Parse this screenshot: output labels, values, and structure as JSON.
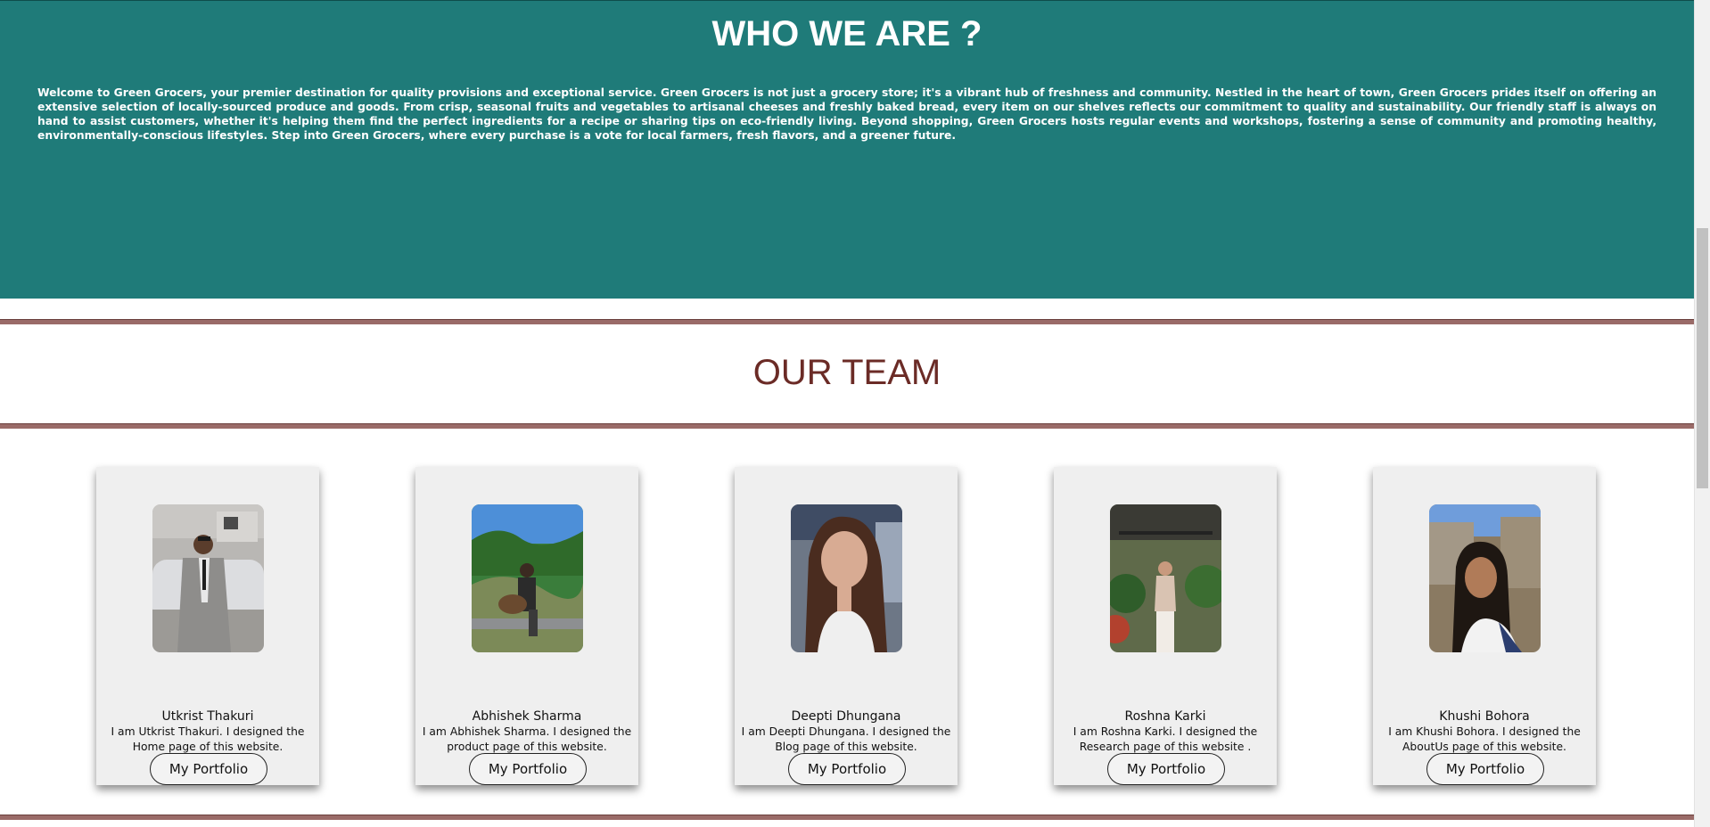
{
  "about": {
    "title": "WHO WE ARE ?",
    "text": "Welcome to Green Grocers, your premier destination for quality provisions and exceptional service. Green Grocers is not just a grocery store; it's a vibrant hub of freshness and community. Nestled in the heart of town, Green Grocers prides itself on offering an extensive selection of locally-sourced produce and goods. From crisp, seasonal fruits and vegetables to artisanal cheeses and freshly baked bread, every item on our shelves reflects our commitment to quality and sustainability. Our friendly staff is always on hand to assist customers, whether it's helping them find the perfect ingredients for a recipe or sharing tips on eco-friendly living. Beyond shopping, Green Grocers hosts regular events and workshops, fostering a sense of community and promoting healthy, environmentally-conscious lifestyles. Step into Green Grocers, where every purchase is a vote for local farmers, fresh flavors, and a greener future."
  },
  "team": {
    "title": "OUR TEAM",
    "members": [
      {
        "name": "Utkrist Thakuri",
        "description": "I am Utkrist Thakuri. I designed the Home page of this website.",
        "button_label": "My Portfolio"
      },
      {
        "name": "Abhishek Sharma",
        "description": "I am Abhishek Sharma. I designed the product page of this website.",
        "button_label": "My Portfolio"
      },
      {
        "name": "Deepti Dhungana",
        "description": "I am Deepti Dhungana. I designed the Blog page of this website.",
        "button_label": "My Portfolio"
      },
      {
        "name": "Roshna Karki",
        "description": "I am Roshna Karki. I designed the Research page of this website .",
        "button_label": "My Portfolio"
      },
      {
        "name": "Khushi Bohora",
        "description": "I am Khushi Bohora. I designed the AboutUs page of this website.",
        "button_label": "My Portfolio"
      }
    ]
  },
  "colors": {
    "about_background": "#1f7b79",
    "team_title": "#6b2b26",
    "divider": "#9a6b68",
    "card_background": "#efefef"
  }
}
